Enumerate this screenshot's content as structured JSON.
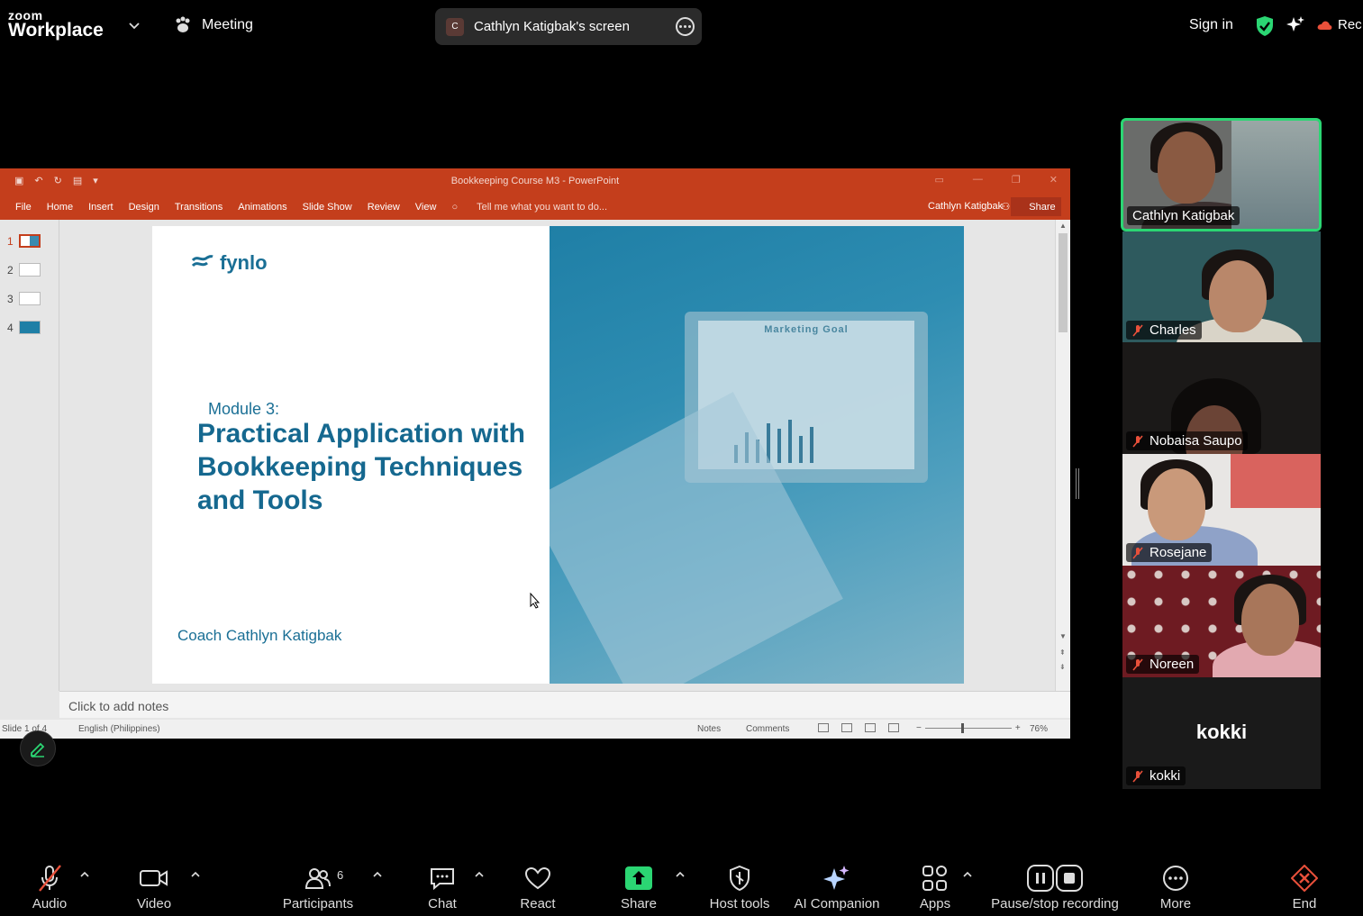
{
  "topbar": {
    "logo_small": "zoom",
    "logo_large": "Workplace",
    "meeting_label": "Meeting",
    "share_avatar_letter": "C",
    "share_label": "Cathlyn Katigbak's screen",
    "sign_in": "Sign in",
    "record_label": "Rec",
    "colors": {
      "shield": "#2bd673",
      "record": "#e8503a"
    }
  },
  "powerpoint": {
    "window_title": "Bookkeeping Course M3 - PowerPoint",
    "ribbon_tabs": [
      "File",
      "Home",
      "Insert",
      "Design",
      "Transitions",
      "Animations",
      "Slide Show",
      "Review",
      "View"
    ],
    "tell_me": "Tell me what you want to do...",
    "user": "Cathlyn Katigbak",
    "share": "Share",
    "thumbnails": [
      "1",
      "2",
      "3",
      "4"
    ],
    "slide": {
      "brand": "fynlo",
      "module": "Module 3:",
      "heading": "Practical Application with Bookkeeping Techniques and Tools",
      "coach": "Coach Cathlyn Katigbak",
      "photo_screen_title": "Marketing Goal"
    },
    "notes_placeholder": "Click to add notes",
    "status": {
      "slide_number": "Slide 1 of 4",
      "language": "English (Philippines)",
      "notes": "Notes",
      "comments": "Comments",
      "zoom": "76%"
    },
    "accent": "#c43e1c"
  },
  "gallery": [
    {
      "name": "Cathlyn Katigbak",
      "muted": false,
      "active": true
    },
    {
      "name": "Charles",
      "muted": true,
      "active": false
    },
    {
      "name": "Nobaisa Saupo",
      "muted": true,
      "active": false
    },
    {
      "name": "Rosejane",
      "muted": true,
      "active": false
    },
    {
      "name": "Noreen",
      "muted": true,
      "active": false
    },
    {
      "name": "kokki",
      "muted": true,
      "active": false,
      "display": "kokki"
    }
  ],
  "toolbar": {
    "audio": "Audio",
    "video": "Video",
    "participants": "Participants",
    "participants_count": "6",
    "chat": "Chat",
    "react": "React",
    "share": "Share",
    "host_tools": "Host tools",
    "ai_companion": "AI Companion",
    "apps": "Apps",
    "pause_stop": "Pause/stop recording",
    "more": "More",
    "end": "End",
    "colors": {
      "share": "#2bd673",
      "end": "#e8503a",
      "muted": "#e8503a"
    }
  }
}
